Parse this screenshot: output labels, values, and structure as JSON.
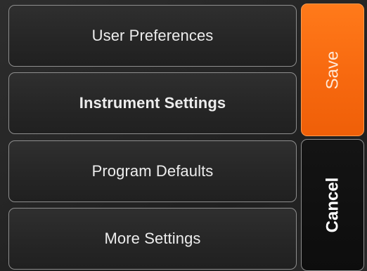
{
  "menu": {
    "items": [
      {
        "label": "User Preferences"
      },
      {
        "label": "Instrument Settings"
      },
      {
        "label": "Program Defaults"
      },
      {
        "label": "More Settings"
      }
    ]
  },
  "actions": {
    "save_label": "Save",
    "cancel_label": "Cancel"
  },
  "colors": {
    "accent": "#f86a10",
    "background": "#262626"
  }
}
